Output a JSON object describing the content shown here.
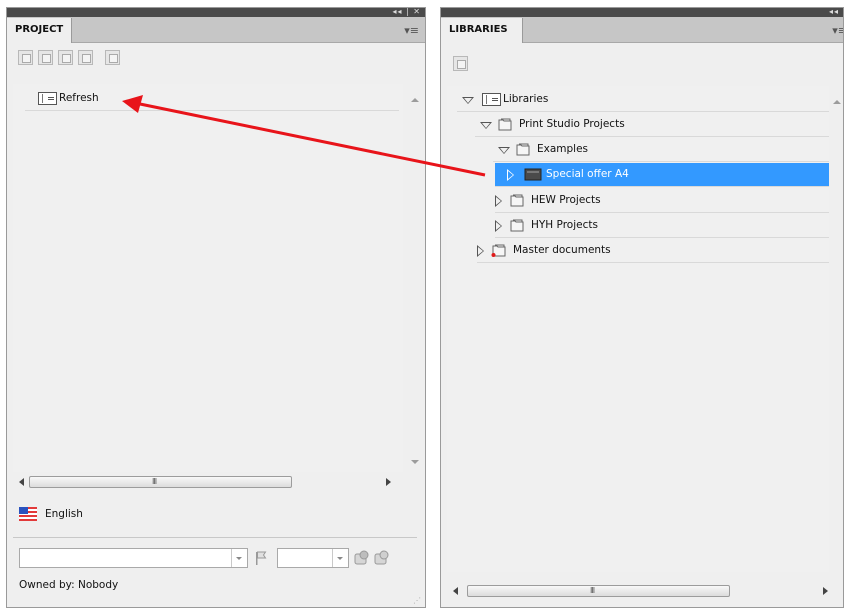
{
  "left_panel": {
    "collapse_glyph": "◂◂ | ✕",
    "tab_label": "PROJECT",
    "menu_glyph": "▾≡",
    "toolbar_icons": [
      "new-document-icon",
      "save-icon",
      "export-icon",
      "import-icon",
      "sync-icon"
    ],
    "tree": [
      {
        "label": "Refresh",
        "icon": "document-icon"
      }
    ],
    "hscroll_grip": "III",
    "language": {
      "label": "English",
      "icon": "us-flag-icon"
    },
    "owner": "Owned by: Nobody"
  },
  "right_panel": {
    "collapse_glyph": "◂◂",
    "tab_label": "LIBRARIES",
    "menu_glyph": "▾≡",
    "toolbar_icons": [
      "refresh-library-icon"
    ],
    "tree": [
      {
        "label": "Libraries",
        "expanded": true,
        "icon": "document-icon"
      },
      {
        "label": "Print Studio Projects",
        "expanded": true,
        "icon": "folder-icon"
      },
      {
        "label": "Examples",
        "expanded": true,
        "icon": "folder-icon"
      },
      {
        "label": "Special offer A4",
        "expanded": false,
        "icon": "project-icon",
        "selected": true
      },
      {
        "label": "HEW Projects",
        "expanded": false,
        "icon": "folder-icon"
      },
      {
        "label": "HYH Projects",
        "expanded": false,
        "icon": "folder-icon"
      },
      {
        "label": "Master documents",
        "expanded": false,
        "icon": "folder-red-dot-icon"
      }
    ],
    "hscroll_grip": "III"
  },
  "annotation": {
    "color": "#e8141a",
    "from": "Special offer A4",
    "to": "Refresh"
  },
  "colors": {
    "selection": "#3399ff",
    "panel_bg": "#efefef",
    "title_bar": "#4a4a4a"
  }
}
